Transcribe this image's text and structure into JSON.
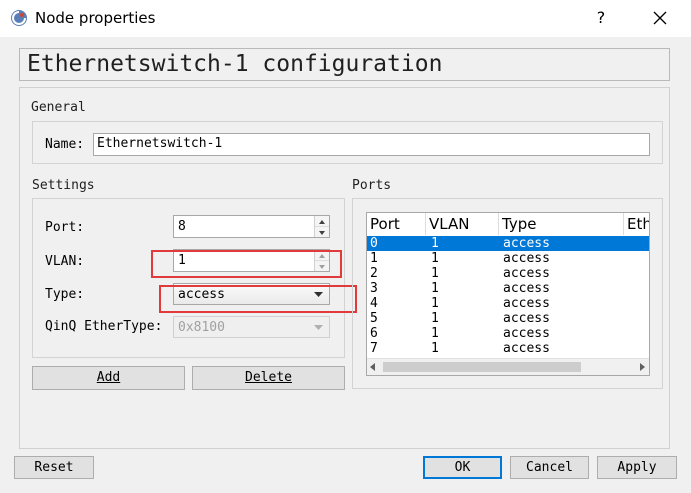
{
  "window": {
    "title": "Node properties",
    "help_label": "?",
    "header": "Ethernetswitch-1 configuration"
  },
  "general": {
    "group_label": "General",
    "name_label": "Name:",
    "name_value": "Ethernetswitch-1"
  },
  "settings": {
    "group_label": "Settings",
    "port_label": "Port:",
    "port_value": "8",
    "vlan_label": "VLAN:",
    "vlan_value": "1",
    "type_label": "Type:",
    "type_value": "access",
    "qinq_label": "QinQ EtherType:",
    "qinq_value": "0x8100"
  },
  "ports": {
    "group_label": "Ports",
    "columns": [
      "Port",
      "VLAN",
      "Type",
      "Eth"
    ],
    "rows": [
      {
        "port": "0",
        "vlan": "1",
        "type": "access",
        "selected": true
      },
      {
        "port": "1",
        "vlan": "1",
        "type": "access"
      },
      {
        "port": "2",
        "vlan": "1",
        "type": "access"
      },
      {
        "port": "3",
        "vlan": "1",
        "type": "access"
      },
      {
        "port": "4",
        "vlan": "1",
        "type": "access"
      },
      {
        "port": "5",
        "vlan": "1",
        "type": "access"
      },
      {
        "port": "6",
        "vlan": "1",
        "type": "access"
      },
      {
        "port": "7",
        "vlan": "1",
        "type": "access"
      }
    ]
  },
  "buttons": {
    "add": "Add",
    "delete": "Delete",
    "reset": "Reset",
    "ok": "OK",
    "cancel": "Cancel",
    "apply": "Apply"
  },
  "colors": {
    "selection": "#0078d7",
    "highlight_box": "#e03a3a"
  }
}
